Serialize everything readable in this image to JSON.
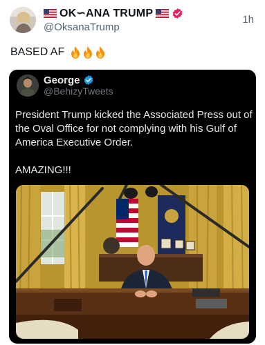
{
  "author": {
    "display_name": "OK∽ANA TRUMP",
    "handle": "@OksanaTrump",
    "time": "1h"
  },
  "tweet": {
    "text": "BASED AF"
  },
  "quoted": {
    "name": "George",
    "handle": "@BehizyTweets",
    "paragraph1": "President Trump kicked the Associated Press out of the Oval Office for not complying with his Gulf of America Executive Order.",
    "paragraph2": "AMAZING!!!"
  },
  "icons": {
    "flag": "us-flag-icon",
    "verified": "verified-badge-icon",
    "fire": "fire-icon"
  },
  "colors": {
    "verified_pink": "#e0245e",
    "verified_blue": "#1d9bf0",
    "quote_background": "#000000"
  }
}
